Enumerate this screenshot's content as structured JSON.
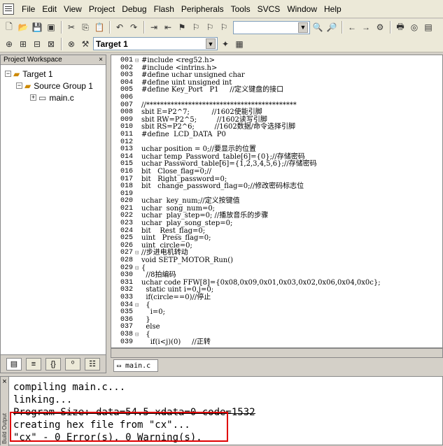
{
  "menu": {
    "items": [
      "File",
      "Edit",
      "View",
      "Project",
      "Debug",
      "Flash",
      "Peripherals",
      "Tools",
      "SVCS",
      "Window",
      "Help"
    ]
  },
  "toolbar2": {
    "target_combo": "Target 1"
  },
  "workspace": {
    "title": "Project Workspace",
    "close": "×",
    "tree": {
      "target": "Target 1",
      "group": "Source Group 1",
      "file": "main.c"
    }
  },
  "editor": {
    "tab_label": "main.c",
    "lines": [
      {
        "n": "001",
        "f": "⊟",
        "t": "#include <reg52.h>"
      },
      {
        "n": "002",
        "f": "",
        "t": "#include <intrins.h>"
      },
      {
        "n": "003",
        "f": "",
        "t": "#define uchar unsigned char"
      },
      {
        "n": "004",
        "f": "",
        "t": "#define uint unsigned int"
      },
      {
        "n": "005",
        "f": "",
        "t": "#define Key_Port   P1     //定义键盘的接口"
      },
      {
        "n": "006",
        "f": "",
        "t": ""
      },
      {
        "n": "007",
        "f": "",
        "t": "//*******************************************"
      },
      {
        "n": "008",
        "f": "",
        "t": "sbit E=P2^7;          //1602使能引脚"
      },
      {
        "n": "009",
        "f": "",
        "t": "sbit RW=P2^5;         //1602读写引脚"
      },
      {
        "n": "010",
        "f": "",
        "t": "sbit RS=P2^6;         //1602数据/命令选择引脚"
      },
      {
        "n": "011",
        "f": "",
        "t": "#define  LCD_DATA  P0"
      },
      {
        "n": "012",
        "f": "",
        "t": ""
      },
      {
        "n": "013",
        "f": "",
        "t": "uchar position = 0;//要显示的位置"
      },
      {
        "n": "014",
        "f": "",
        "t": "uchar temp_Password_table[6]={0};//存储密码"
      },
      {
        "n": "015",
        "f": "",
        "t": "uchar Password_table[6]={1,2,3,4,5,6};//存储密码"
      },
      {
        "n": "016",
        "f": "",
        "t": "bit   Close_flag=0;//"
      },
      {
        "n": "017",
        "f": "",
        "t": "bit   Right_password=0;"
      },
      {
        "n": "018",
        "f": "",
        "t": "bit   change_password_flag=0;//修改密码标志位"
      },
      {
        "n": "019",
        "f": "",
        "t": ""
      },
      {
        "n": "020",
        "f": "",
        "t": "uchar  key_num;//定义按键值"
      },
      {
        "n": "021",
        "f": "",
        "t": "uchar  song_num=0;"
      },
      {
        "n": "022",
        "f": "",
        "t": "uchar  play_step=0; //播放音乐的步骤"
      },
      {
        "n": "023",
        "f": "",
        "t": "uchar  play_song_step=0;"
      },
      {
        "n": "024",
        "f": "",
        "t": "bit    Rest_flag=0;"
      },
      {
        "n": "025",
        "f": "",
        "t": "uint   Press_flag=0;"
      },
      {
        "n": "026",
        "f": "",
        "t": "uint  circle=0;"
      },
      {
        "n": "027",
        "f": "⊟",
        "t": "//步进电机转动"
      },
      {
        "n": "028",
        "f": "",
        "t": "void SETP_MOTOR_Run()"
      },
      {
        "n": "029",
        "f": "⊟",
        "t": "{"
      },
      {
        "n": "030",
        "f": "",
        "t": "  //8拍编码"
      },
      {
        "n": "031",
        "f": "",
        "t": "uchar code FFW[8]={0x08,0x09,0x01,0x03,0x02,0x06,0x04,0x0c};"
      },
      {
        "n": "032",
        "f": "",
        "t": "  static uint i=0,j=0;"
      },
      {
        "n": "033",
        "f": "",
        "t": "  if(circle==0)//停止"
      },
      {
        "n": "034",
        "f": "⊟",
        "t": "  {"
      },
      {
        "n": "035",
        "f": "",
        "t": "    i=0;"
      },
      {
        "n": "036",
        "f": "",
        "t": "  }"
      },
      {
        "n": "037",
        "f": "",
        "t": "  else"
      },
      {
        "n": "038",
        "f": "⊟",
        "t": "  {"
      },
      {
        "n": "039",
        "f": "",
        "t": "    if(i<j)(0)     //正转"
      }
    ]
  },
  "output": {
    "lines": [
      "compiling main.c...",
      "linking...",
      "Program Size: data=54.5 xdata=0 code=1532",
      "creating hex file from \"cx\"...",
      "\"cx\" - 0 Error(s), 0 Warning(s)."
    ],
    "side_label": "Build Output",
    "close": "×"
  }
}
